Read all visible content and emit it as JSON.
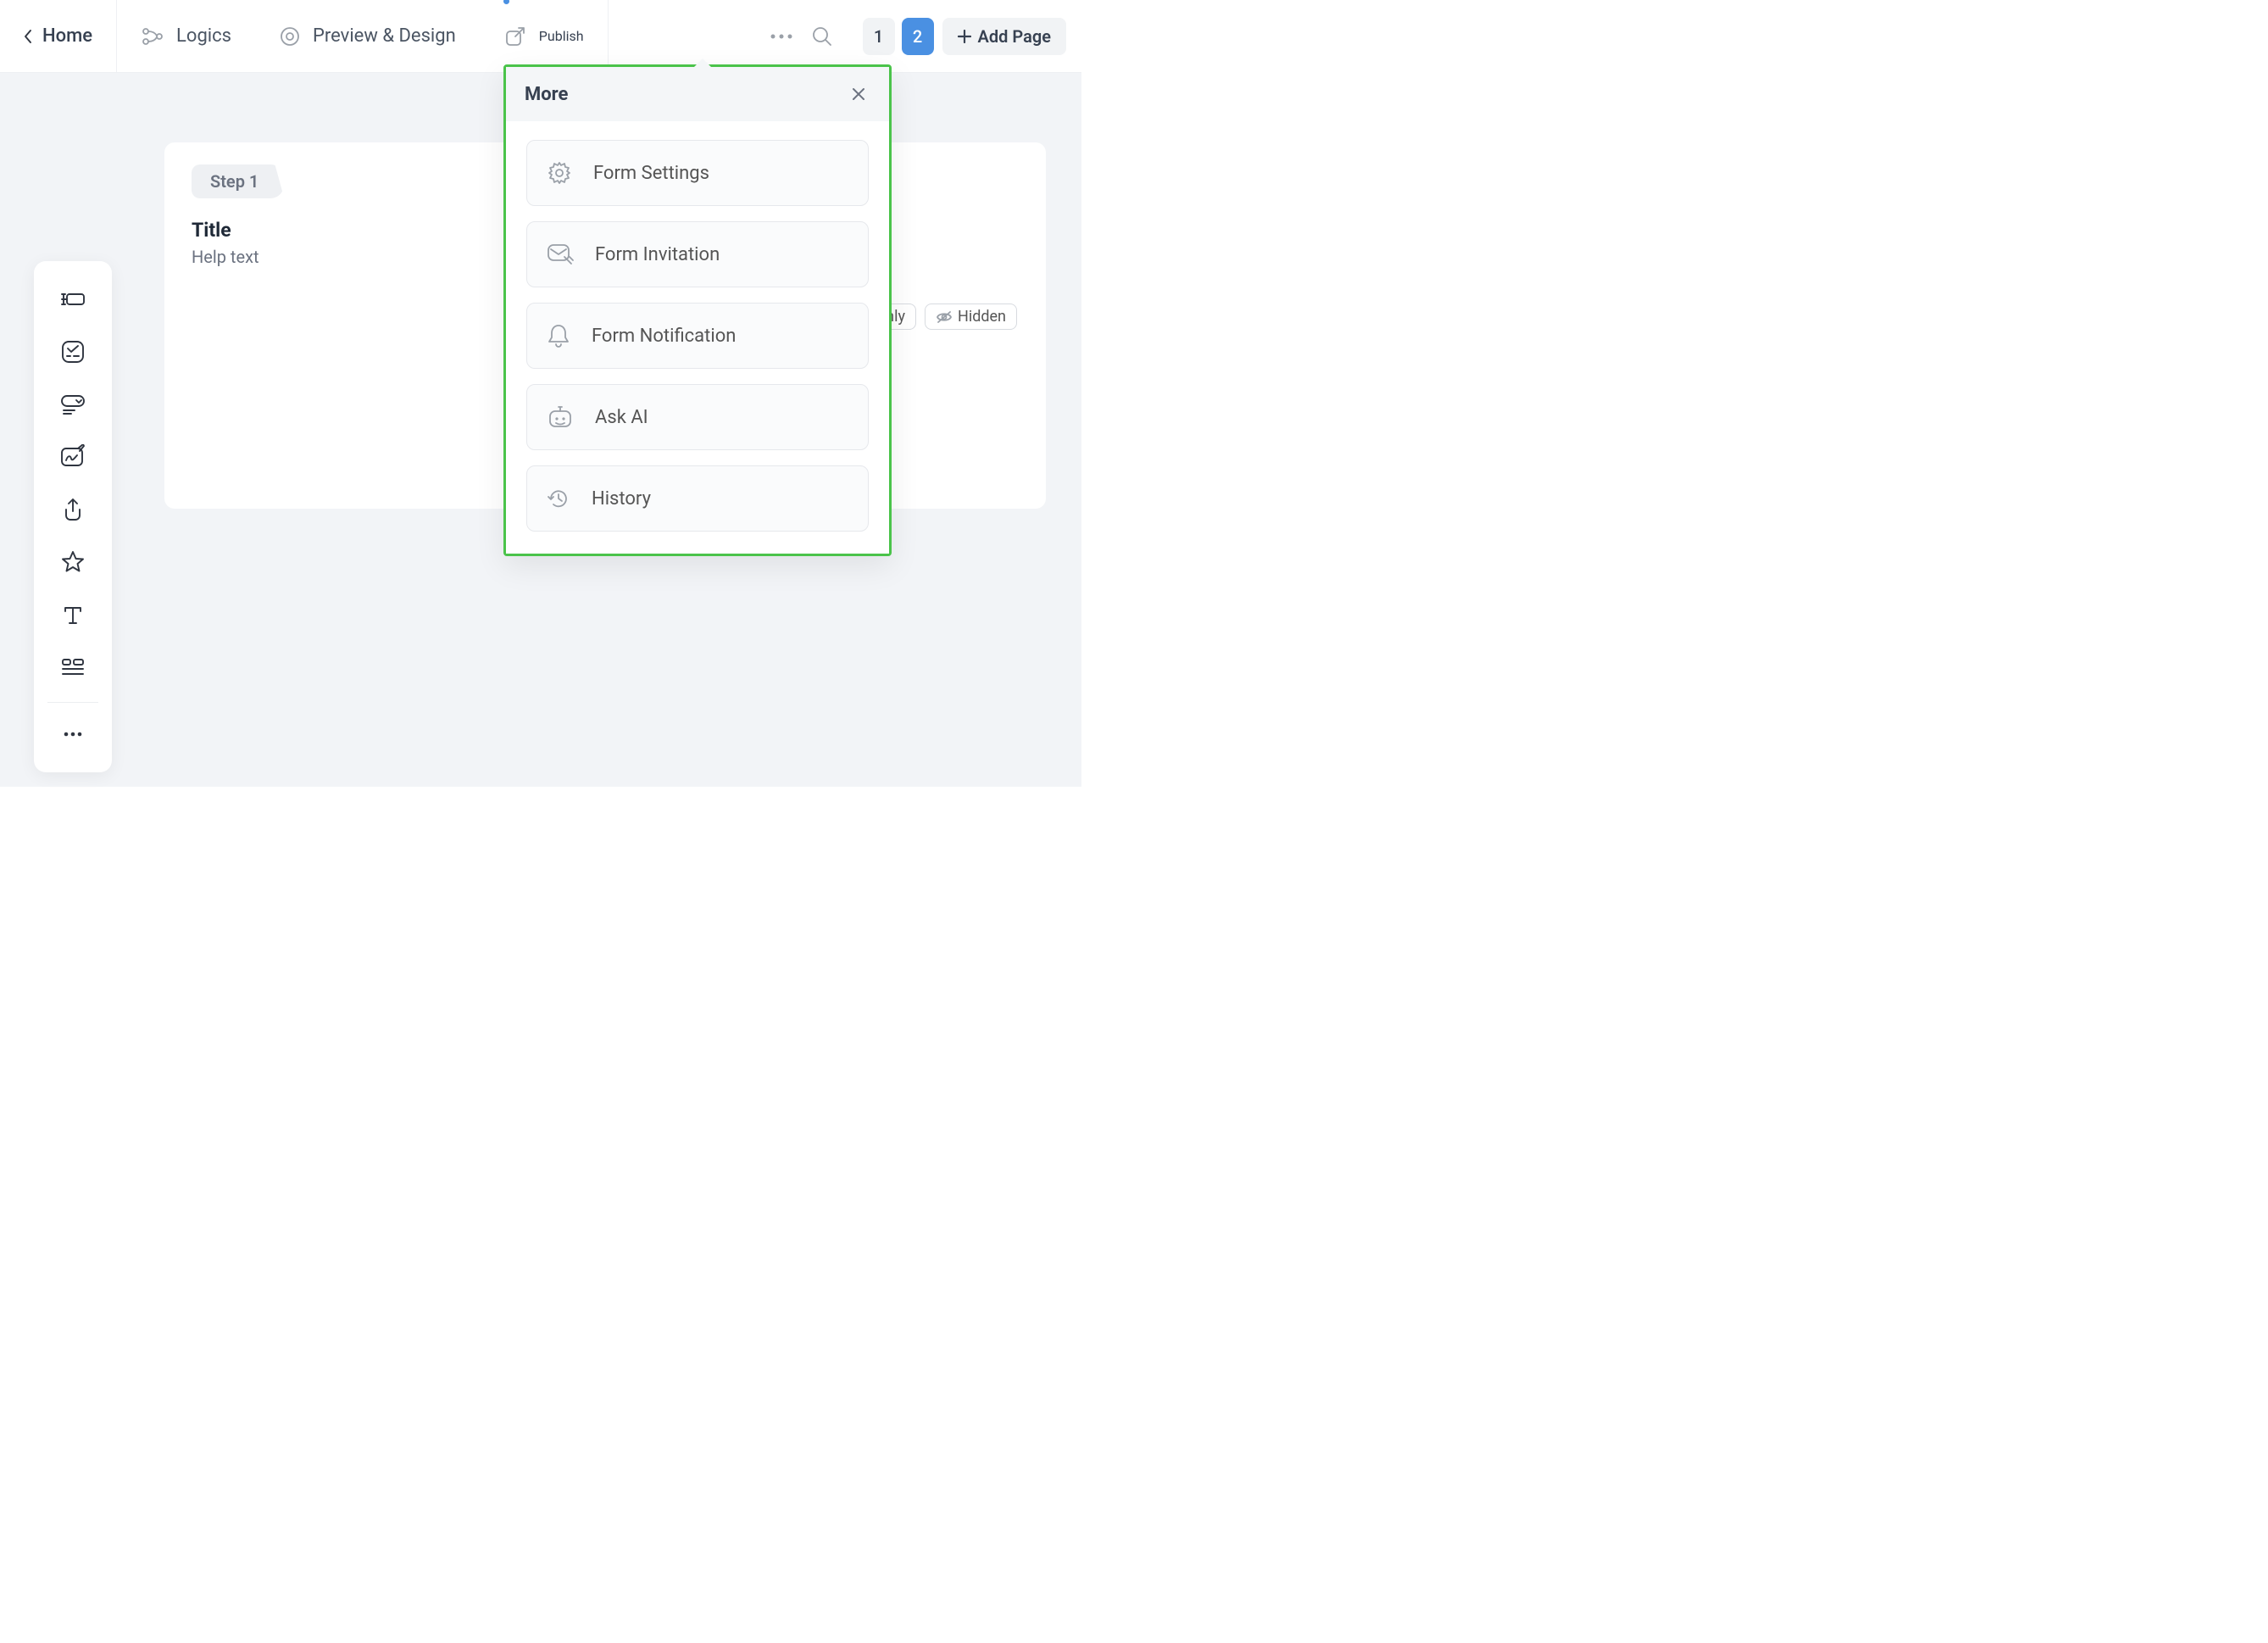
{
  "nav": {
    "home": "Home",
    "logics": "Logics",
    "preview_design": "Preview & Design",
    "publish": "Publish"
  },
  "pages": {
    "p1": "1",
    "p2": "2",
    "active_index": 1,
    "add_label": "Add Page"
  },
  "form": {
    "step_label": "Step 1",
    "title": "Title",
    "help": "Help text"
  },
  "field_tags": {
    "readonly_tail": "nly",
    "hidden": "Hidden"
  },
  "more_panel": {
    "title": "More",
    "items": {
      "0": "Form Settings",
      "1": "Form Invitation",
      "2": "Form Notification",
      "3": "Ask AI",
      "4": "History"
    }
  }
}
